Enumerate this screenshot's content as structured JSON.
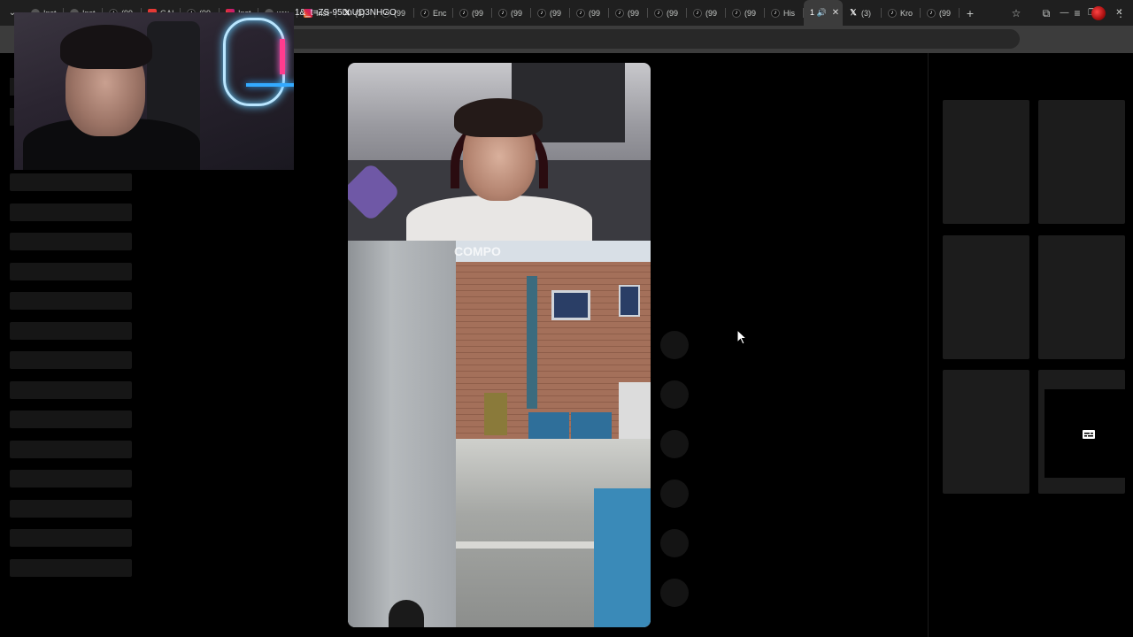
{
  "browser": {
    "tabs": [
      {
        "icon": "generic",
        "label": "Inst"
      },
      {
        "icon": "generic",
        "label": "Inst"
      },
      {
        "icon": "tiktok",
        "label": "(99"
      },
      {
        "icon": "yt",
        "label": "GAI"
      },
      {
        "icon": "tiktok",
        "label": "(99"
      },
      {
        "icon": "insta",
        "label": "Inst"
      },
      {
        "icon": "generic",
        "label": "ww"
      },
      {
        "icon": "insta",
        "label": "Inst"
      },
      {
        "icon": "x",
        "label": "(3)"
      },
      {
        "icon": "tiktok",
        "label": "(99"
      },
      {
        "icon": "tiktok",
        "label": "Enc"
      },
      {
        "icon": "tiktok",
        "label": "(99"
      },
      {
        "icon": "tiktok",
        "label": "(99"
      },
      {
        "icon": "tiktok",
        "label": "(99"
      },
      {
        "icon": "tiktok",
        "label": "(99"
      },
      {
        "icon": "tiktok",
        "label": "(99"
      },
      {
        "icon": "tiktok",
        "label": "(99"
      },
      {
        "icon": "tiktok",
        "label": "(99"
      },
      {
        "icon": "tiktok",
        "label": "(99"
      },
      {
        "icon": "tiktok",
        "label": "His"
      },
      {
        "icon": "none",
        "label": "1 🔊",
        "active": true
      },
      {
        "icon": "x",
        "label": "(3)"
      },
      {
        "icon": "tiktok",
        "label": "Kro"
      },
      {
        "icon": "tiktok",
        "label": "(99"
      }
    ],
    "new_tab_label": "+",
    "search_tabs_label": "⌄",
    "url": "1&_t=ZS-95LnUD3NHGO",
    "window_controls": {
      "minimize": "—",
      "restore": "❐",
      "close": "✕"
    },
    "toolbar_icons": {
      "bookmark": "☆",
      "extensions": "⧉",
      "media": "≡",
      "menu": "⋮"
    }
  },
  "hover_card": {
    "icon": "captions-icon"
  },
  "video": {
    "overlay_text": "COMPO"
  },
  "colors": {
    "tab_strip": "#1f1f1f",
    "toolbar": "#3c3c3c",
    "page_bg": "#000000",
    "skeleton": "#161616",
    "thumb": "#1c1c1c"
  }
}
